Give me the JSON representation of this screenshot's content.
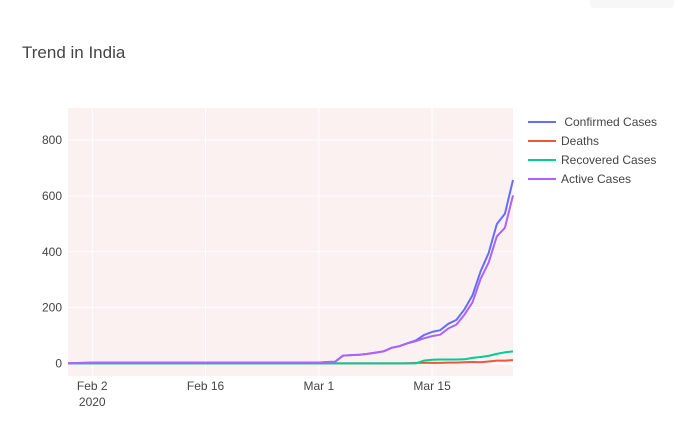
{
  "chart_data": {
    "type": "line",
    "title": "Trend in India",
    "xlabel": "",
    "ylabel": "",
    "x_axis": {
      "type": "date",
      "range": [
        "2020-01-30",
        "2020-03-25"
      ],
      "ticks": [
        {
          "date": "2020-02-02",
          "label": "Feb 2",
          "sublabel": "2020"
        },
        {
          "date": "2020-02-16",
          "label": "Feb 16",
          "sublabel": ""
        },
        {
          "date": "2020-03-01",
          "label": "Mar 1",
          "sublabel": ""
        },
        {
          "date": "2020-03-15",
          "label": "Mar 15",
          "sublabel": ""
        }
      ]
    },
    "y_axis": {
      "range": [
        -45,
        915
      ],
      "ticks": [
        0,
        200,
        400,
        600,
        800
      ]
    },
    "grid": true,
    "plot_background": "#fbf1f1",
    "legend_position": "right",
    "dates": [
      "2020-01-30",
      "2020-02-02",
      "2020-02-16",
      "2020-03-01",
      "2020-03-02",
      "2020-03-03",
      "2020-03-04",
      "2020-03-05",
      "2020-03-06",
      "2020-03-07",
      "2020-03-08",
      "2020-03-09",
      "2020-03-10",
      "2020-03-11",
      "2020-03-12",
      "2020-03-13",
      "2020-03-14",
      "2020-03-15",
      "2020-03-16",
      "2020-03-17",
      "2020-03-18",
      "2020-03-19",
      "2020-03-20",
      "2020-03-21",
      "2020-03-22",
      "2020-03-23",
      "2020-03-24",
      "2020-03-25"
    ],
    "series": [
      {
        "name": " Confirmed Cases",
        "color": "#636efa",
        "values": [
          1,
          3,
          3,
          3,
          5,
          6,
          28,
          30,
          31,
          34,
          39,
          43,
          56,
          62,
          73,
          82,
          102,
          113,
          119,
          142,
          156,
          194,
          244,
          330,
          396,
          499,
          536,
          657
        ]
      },
      {
        "name": "Deaths",
        "color": "#ef553b",
        "values": [
          0,
          0,
          0,
          0,
          0,
          0,
          0,
          0,
          0,
          0,
          0,
          0,
          0,
          0,
          1,
          2,
          2,
          2,
          2,
          3,
          3,
          4,
          5,
          4,
          7,
          10,
          10,
          12
        ]
      },
      {
        "name": "Recovered Cases",
        "color": "#00cc96",
        "values": [
          0,
          0,
          0,
          0,
          0,
          0,
          0,
          0,
          0,
          0,
          0,
          0,
          0,
          0,
          0,
          0,
          10,
          13,
          14,
          14,
          14,
          15,
          20,
          23,
          27,
          34,
          40,
          43
        ]
      },
      {
        "name": "Active Cases",
        "color": "#ab63fa",
        "values": [
          1,
          3,
          3,
          3,
          5,
          6,
          28,
          30,
          31,
          34,
          39,
          43,
          56,
          62,
          72,
          80,
          90,
          98,
          103,
          125,
          139,
          175,
          219,
          303,
          362,
          455,
          486,
          602
        ]
      }
    ]
  }
}
